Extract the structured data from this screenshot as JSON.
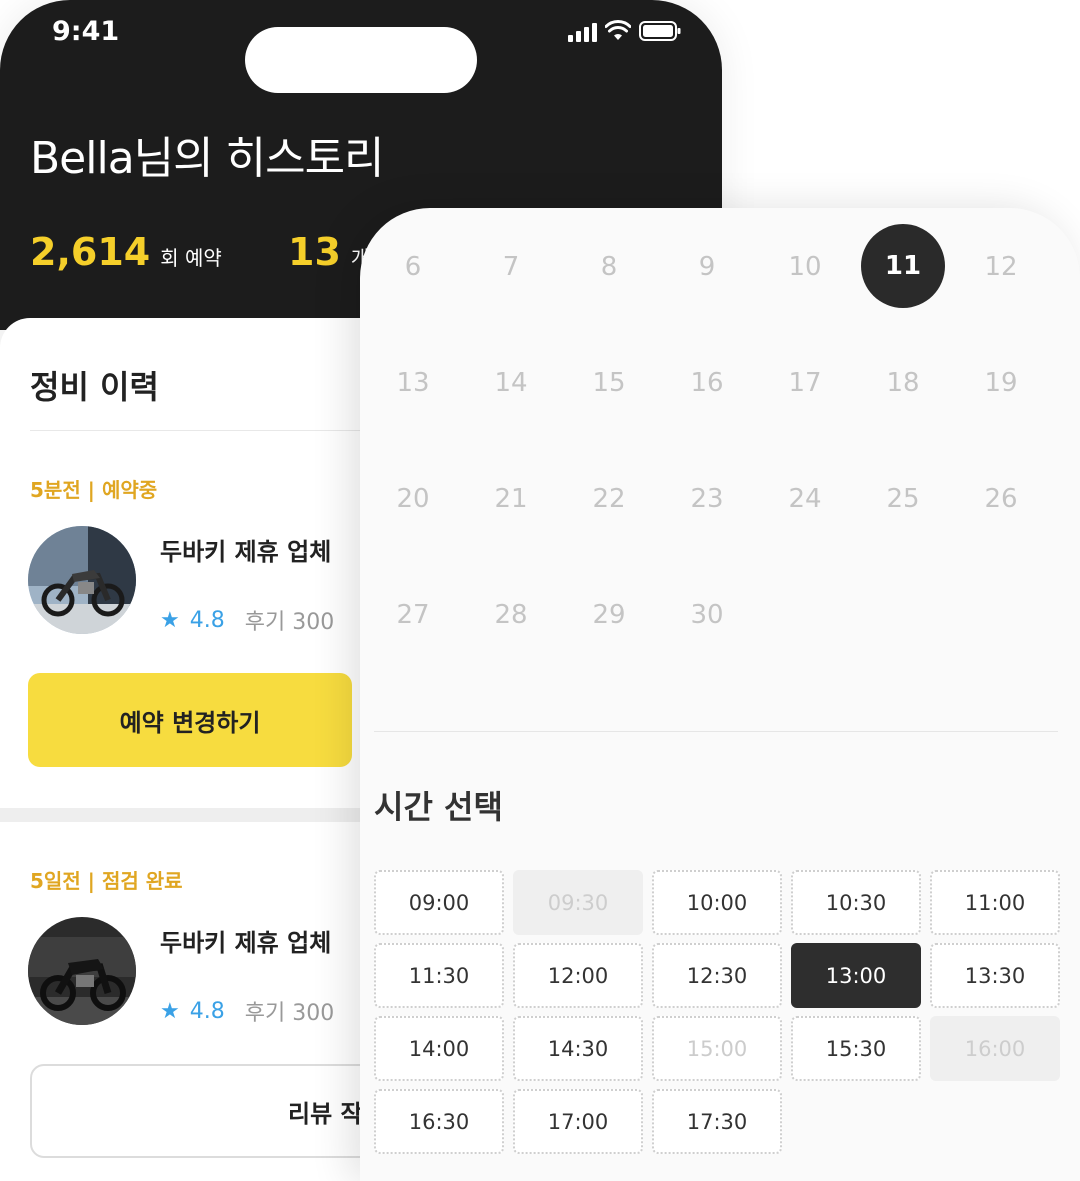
{
  "status_bar": {
    "time": "9:41"
  },
  "history": {
    "title": "Bella님의 히스토리",
    "stats": [
      {
        "value": "2,614",
        "unit": "회 예약"
      },
      {
        "value": "13",
        "unit": "개 ㅎ"
      }
    ]
  },
  "maintenance": {
    "section_title": "정비 이력",
    "items": [
      {
        "status": "5분전 | 예약중",
        "shop": "두바키 제휴 업체",
        "rating": "4.8",
        "reviews": "후기 300",
        "button": "예약 변경하기"
      },
      {
        "status": "5일전 | 점검 완료",
        "shop": "두바키 제휴 업체",
        "rating": "4.8",
        "reviews": "후기 300",
        "button": "리뷰 작"
      }
    ]
  },
  "calendar": {
    "days": [
      "6",
      "7",
      "8",
      "9",
      "10",
      "11",
      "12",
      "13",
      "14",
      "15",
      "16",
      "17",
      "18",
      "19",
      "20",
      "21",
      "22",
      "23",
      "24",
      "25",
      "26",
      "27",
      "28",
      "29",
      "30"
    ],
    "selected_day": "11"
  },
  "time_selection": {
    "title": "시간 선택",
    "slots": [
      {
        "label": "09:00",
        "state": "available"
      },
      {
        "label": "09:30",
        "state": "disabled"
      },
      {
        "label": "10:00",
        "state": "available"
      },
      {
        "label": "10:30",
        "state": "available"
      },
      {
        "label": "11:00",
        "state": "available"
      },
      {
        "label": "11:30",
        "state": "available"
      },
      {
        "label": "12:00",
        "state": "available"
      },
      {
        "label": "12:30",
        "state": "available"
      },
      {
        "label": "13:00",
        "state": "selected"
      },
      {
        "label": "13:30",
        "state": "available"
      },
      {
        "label": "14:00",
        "state": "available"
      },
      {
        "label": "14:30",
        "state": "available"
      },
      {
        "label": "15:00",
        "state": "faded"
      },
      {
        "label": "15:30",
        "state": "available"
      },
      {
        "label": "16:00",
        "state": "disabled"
      },
      {
        "label": "16:30",
        "state": "available"
      },
      {
        "label": "17:00",
        "state": "available"
      },
      {
        "label": "17:30",
        "state": "available"
      }
    ]
  },
  "colors": {
    "accent_yellow": "#f7dc3f",
    "status_orange": "#e0a621",
    "rating_blue": "#3aa1e6",
    "dark": "#1c1c1c"
  }
}
